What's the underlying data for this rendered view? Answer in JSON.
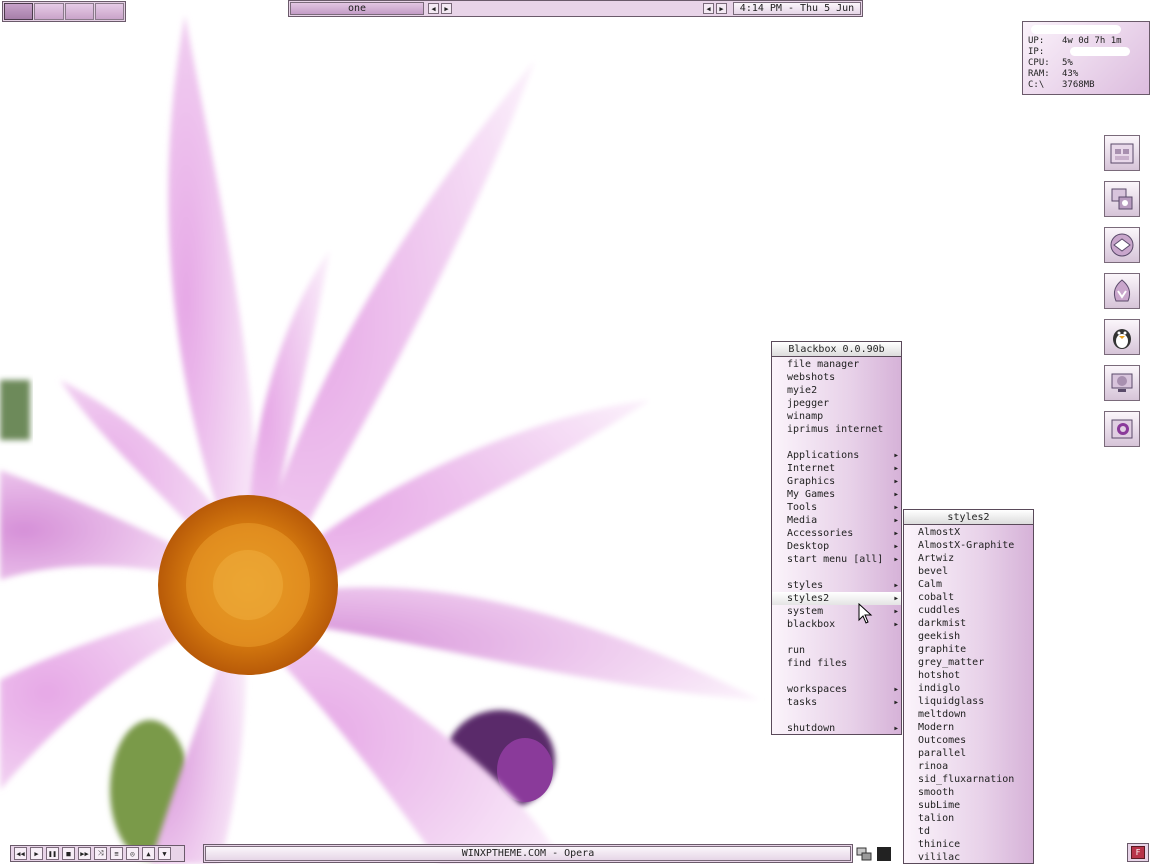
{
  "toolbar": {
    "workspace_label": "one",
    "clock": "4:14 PM - Thu 5 Jun",
    "prev_icon": "arrow-left-icon",
    "next_icon": "arrow-right-icon"
  },
  "pager": {
    "workspace_count": 4,
    "active_index": 0
  },
  "sysmon": {
    "rows": [
      {
        "key": "UP:",
        "value": "4w 0d 7h 1m"
      },
      {
        "key": "IP:",
        "value": ""
      },
      {
        "key": "CPU:",
        "value": "5%"
      },
      {
        "key": "RAM:",
        "value": "43%"
      },
      {
        "key": "C:\\",
        "value": "3768MB"
      }
    ]
  },
  "dock": {
    "icons": [
      "file-manager-icon",
      "control-panel-icon",
      "browser-icon",
      "winamp-icon",
      "tux-penguin-icon",
      "desktop-settings-icon",
      "opera-icon"
    ]
  },
  "main_menu": {
    "title": "Blackbox 0.0.90b",
    "items": [
      {
        "label": "file manager",
        "submenu": false
      },
      {
        "label": "webshots",
        "submenu": false
      },
      {
        "label": "myie2",
        "submenu": false
      },
      {
        "label": "jpegger",
        "submenu": false
      },
      {
        "label": "winamp",
        "submenu": false
      },
      {
        "label": "iprimus internet",
        "submenu": false
      },
      {
        "label": "",
        "separator": true
      },
      {
        "label": "Applications",
        "submenu": true
      },
      {
        "label": "Internet",
        "submenu": true
      },
      {
        "label": "Graphics",
        "submenu": true
      },
      {
        "label": "My Games",
        "submenu": true
      },
      {
        "label": "Tools",
        "submenu": true
      },
      {
        "label": "Media",
        "submenu": true
      },
      {
        "label": "Accessories",
        "submenu": true
      },
      {
        "label": "Desktop",
        "submenu": true
      },
      {
        "label": "start menu [all]",
        "submenu": true
      },
      {
        "label": "",
        "separator": true
      },
      {
        "label": "styles",
        "submenu": true
      },
      {
        "label": "styles2",
        "submenu": true,
        "active": true
      },
      {
        "label": "system",
        "submenu": true
      },
      {
        "label": "blackbox",
        "submenu": true
      },
      {
        "label": "",
        "separator": true
      },
      {
        "label": "run",
        "submenu": false
      },
      {
        "label": "find files",
        "submenu": false
      },
      {
        "label": "",
        "separator": true
      },
      {
        "label": "workspaces",
        "submenu": true
      },
      {
        "label": "tasks",
        "submenu": true
      },
      {
        "label": "",
        "separator": true
      },
      {
        "label": "shutdown",
        "submenu": true
      }
    ]
  },
  "sub_menu": {
    "title": "styles2",
    "items": [
      "AlmostX",
      "AlmostX-Graphite",
      "Artwiz",
      "bevel",
      "Calm",
      "cobalt",
      "cuddles",
      "darkmist",
      "geekish",
      "graphite",
      "grey_matter",
      "hotshot",
      "indiglo",
      "liquidglass",
      "meltdown",
      "Modern",
      "Outcomes",
      "parallel",
      "rinoa",
      "sid_fluxarnation",
      "smooth",
      "subLime",
      "talion",
      "td",
      "thinice",
      "vililac"
    ]
  },
  "media_controls": {
    "buttons": [
      {
        "name": "rewind-icon",
        "glyph": "◀◀"
      },
      {
        "name": "play-icon",
        "glyph": "▶"
      },
      {
        "name": "pause-icon",
        "glyph": "❚❚"
      },
      {
        "name": "stop-icon",
        "glyph": "■"
      },
      {
        "name": "fast-forward-icon",
        "glyph": "▶▶"
      },
      {
        "name": "shuffle-icon",
        "glyph": "⤨"
      },
      {
        "name": "playlist-icon",
        "glyph": "≡"
      },
      {
        "name": "eq-icon",
        "glyph": "◎"
      },
      {
        "name": "volume-up-icon",
        "glyph": "▲"
      },
      {
        "name": "volume-down-icon",
        "glyph": "▼"
      }
    ]
  },
  "taskbar": {
    "active_task": "WINXPTHEME.COM - Opera"
  },
  "corner": {
    "glyph": "F"
  }
}
